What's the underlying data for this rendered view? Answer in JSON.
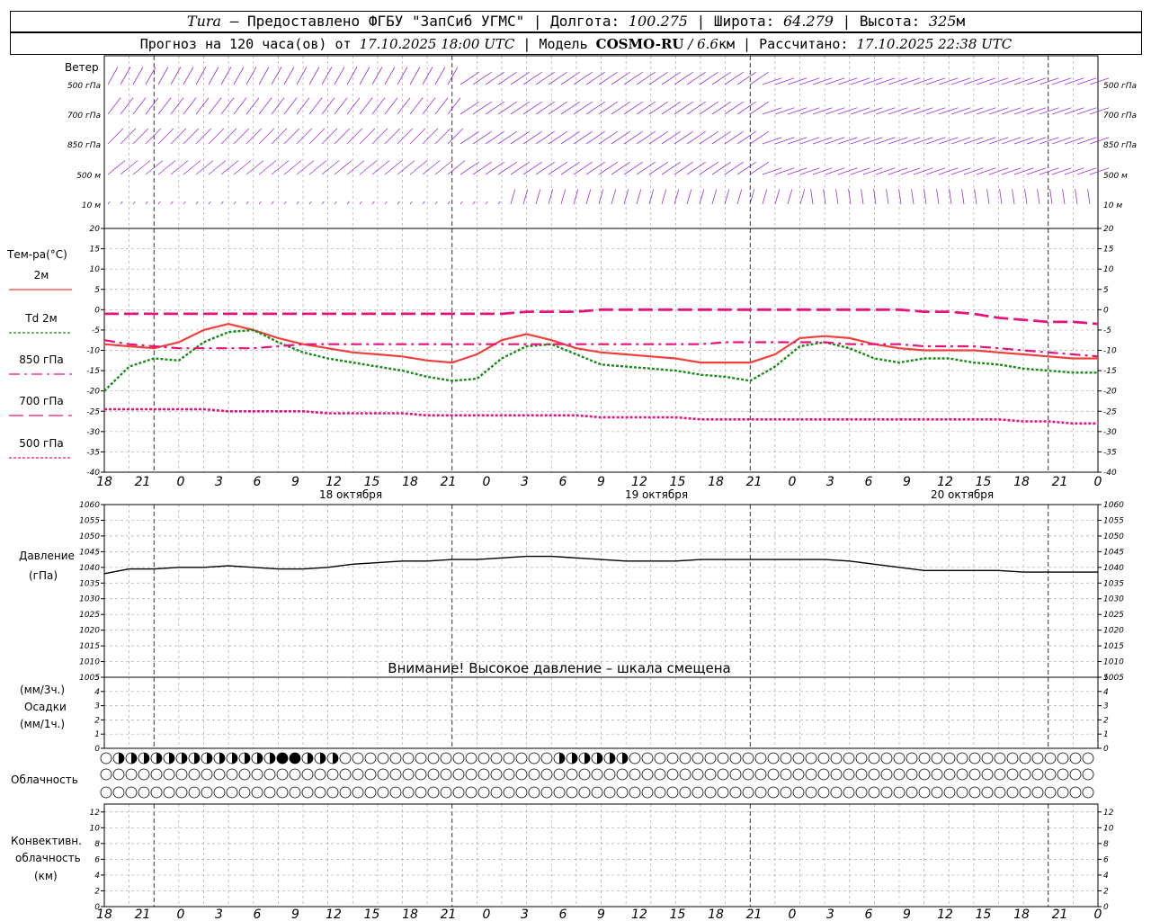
{
  "header": {
    "station": "Tura",
    "provider": " – Предоставлено ФГБУ \"ЗапСиб УГМС\" | Долгота: ",
    "lon": "100.275",
    "lat_label": " | Широта: ",
    "lat": "64.279",
    "alt_label": " | Высота: ",
    "alt": "325",
    "alt_unit": "м",
    "forecast_label": "Прогноз на 120 часа(ов) от ",
    "forecast_start": "17.10.2025 18:00 UTC",
    "model_label": " | Модель ",
    "model_name": "COSMO-RU",
    "model_res": " / 6.6",
    "model_res_unit": "км | Рассчитано: ",
    "computed": "17.10.2025 22:38 UTC"
  },
  "panels": {
    "wind_title": "Ветер",
    "wind_levels": [
      "500 гПа",
      "700 гПа",
      "850 гПа",
      "500 м",
      "10  м"
    ],
    "temp_title": "Тем-ра(°C)",
    "pressure_title": "Давление",
    "pressure_unit": "(гПа)",
    "pressure_warning": "Внимание! Высокое давление – шкала смещена",
    "precip_unit3": "(мм/3ч.)",
    "precip_title": "Осадки",
    "precip_unit1": "(мм/1ч.)",
    "cloud_title": "Облачность",
    "conv_title1": "Конвективн.",
    "conv_title2": "облачность",
    "conv_unit": "(км)"
  },
  "legend": [
    {
      "label": "2м",
      "color": "#f0403c",
      "style": "solid"
    },
    {
      "label": "Td  2м",
      "color": "#1a8a1a",
      "style": "dotted"
    },
    {
      "label": "850 гПа",
      "color": "#e6147a",
      "style": "dashdot"
    },
    {
      "label": "700 гПа",
      "color": "#e6147a",
      "style": "dashed"
    },
    {
      "label": "500 гПа",
      "color": "#e6147a",
      "style": "dotted"
    }
  ],
  "chart_data": [
    {
      "type": "line",
      "name": "temperature",
      "x_hours": [
        0,
        3,
        6,
        9,
        12,
        15,
        18,
        21,
        24,
        27,
        30,
        33,
        36,
        39,
        42,
        45,
        48,
        51,
        54,
        57,
        60,
        63,
        66,
        69,
        72,
        75,
        78,
        81,
        84,
        87,
        90,
        93,
        96,
        99,
        102,
        105,
        108,
        111,
        114,
        117,
        120
      ],
      "x_tick_labels": [
        "18",
        "21",
        "0",
        "3",
        "6",
        "9",
        "12",
        "15",
        "18",
        "21",
        "0",
        "3",
        "6",
        "9",
        "12",
        "15",
        "18",
        "21",
        "0",
        "3",
        "6",
        "9",
        "12",
        "15",
        "18",
        "21",
        "0"
      ],
      "day_labels": [
        "18 октября",
        "19 октября",
        "20 октября"
      ],
      "ylim": [
        -40,
        20
      ],
      "y_ticks": [
        20,
        15,
        10,
        5,
        0,
        -5,
        -10,
        -15,
        -20,
        -25,
        -30,
        -35,
        -40
      ],
      "series": [
        {
          "name": "2м",
          "values": [
            -8.5,
            -9,
            -9.5,
            -8,
            -5,
            -3.5,
            -5,
            -7,
            -8.5,
            -9.5,
            -10.5,
            -11,
            -11.5,
            -12.5,
            -13,
            -11,
            -7.5,
            -6,
            -7.5,
            -9.5,
            -10.5,
            -11,
            -11.5,
            -12,
            -13,
            -13,
            -13,
            -11,
            -7,
            -6.5,
            -7,
            -8.5,
            -9.5,
            -10,
            -10,
            -10,
            -10.5,
            -11,
            -11.5,
            -12,
            -12
          ]
        },
        {
          "name": "Td  2м",
          "values": [
            -20,
            -14,
            -12,
            -12.5,
            -8,
            -5.5,
            -5,
            -8,
            -10.5,
            -12,
            -13,
            -14,
            -15,
            -16.5,
            -17.5,
            -17,
            -12,
            -9,
            -8.5,
            -11,
            -13.5,
            -14,
            -14.5,
            -15,
            -16,
            -16.5,
            -17.5,
            -14,
            -9,
            -8,
            -9.5,
            -12,
            -13,
            -12,
            -12,
            -13,
            -13.5,
            -14.5,
            -15,
            -15.5,
            -15.5
          ]
        },
        {
          "name": "850 гПа",
          "values": [
            -7.5,
            -8.5,
            -9,
            -9.5,
            -9.5,
            -9.5,
            -9.5,
            -9,
            -8.5,
            -8.5,
            -8.5,
            -8.5,
            -8.5,
            -8.5,
            -8.5,
            -8.5,
            -8.5,
            -8.5,
            -8.5,
            -8.5,
            -8.5,
            -8.5,
            -8.5,
            -8.5,
            -8.5,
            -8,
            -8,
            -8,
            -8,
            -8,
            -8.5,
            -8.5,
            -8.5,
            -9,
            -9,
            -9,
            -9.5,
            -10,
            -10.5,
            -11,
            -11.5
          ]
        },
        {
          "name": "700 гПа",
          "values": [
            -1,
            -1,
            -1,
            -1,
            -1,
            -1,
            -1,
            -1,
            -1,
            -1,
            -1,
            -1,
            -1,
            -1,
            -1,
            -1,
            -1,
            -0.5,
            -0.5,
            -0.5,
            0,
            0,
            0,
            0,
            0,
            0,
            0,
            0,
            0,
            0,
            0,
            0,
            0,
            -0.5,
            -0.5,
            -1,
            -2,
            -2.5,
            -3,
            -3,
            -3.5
          ]
        },
        {
          "name": "500 гПа",
          "values": [
            -24.5,
            -24.5,
            -24.5,
            -24.5,
            -24.5,
            -25,
            -25,
            -25,
            -25,
            -25.5,
            -25.5,
            -25.5,
            -25.5,
            -26,
            -26,
            -26,
            -26,
            -26,
            -26,
            -26,
            -26.5,
            -26.5,
            -26.5,
            -26.5,
            -27,
            -27,
            -27,
            -27,
            -27,
            -27,
            -27,
            -27,
            -27,
            -27,
            -27,
            -27,
            -27,
            -27.5,
            -27.5,
            -28,
            -28
          ]
        }
      ]
    },
    {
      "type": "line",
      "name": "pressure",
      "ylim": [
        1005,
        1060
      ],
      "y_ticks": [
        1060,
        1055,
        1050,
        1045,
        1040,
        1035,
        1030,
        1025,
        1020,
        1015,
        1010,
        1005
      ],
      "series": [
        {
          "name": "pressure",
          "values": [
            1038,
            1039.5,
            1039.5,
            1040,
            1040,
            1040.5,
            1040,
            1039.5,
            1039.5,
            1040,
            1041,
            1041.5,
            1042,
            1042,
            1042.5,
            1042.5,
            1043,
            1043.5,
            1043.5,
            1043,
            1042.5,
            1042,
            1042,
            1042,
            1042.5,
            1042.5,
            1042.5,
            1042.5,
            1042.5,
            1042.5,
            1042,
            1041,
            1040,
            1039,
            1039,
            1039,
            1039,
            1038.5,
            1038.5,
            1038.5,
            1038.5
          ]
        }
      ]
    },
    {
      "type": "bar",
      "name": "precipitation",
      "ylim": [
        0,
        5
      ],
      "y_ticks": [
        5,
        4,
        3,
        2,
        1,
        0
      ],
      "values": []
    },
    {
      "type": "bar",
      "name": "convective_cloud",
      "ylim": [
        0,
        13
      ],
      "y_ticks": [
        12,
        10,
        8,
        6,
        4,
        2,
        0
      ],
      "values": []
    }
  ],
  "cloud_rows": {
    "row1": [
      0,
      1,
      2,
      2,
      2,
      2,
      2,
      2,
      2,
      1,
      1,
      2,
      2,
      2,
      3,
      3,
      2,
      2,
      1,
      0,
      0,
      0,
      0,
      0,
      0,
      0,
      0,
      0,
      0,
      0,
      0,
      0,
      0,
      0,
      0,
      0,
      1,
      2,
      2,
      2,
      2,
      2,
      0,
      0,
      0,
      0,
      0,
      0,
      0,
      0,
      0,
      0,
      0,
      0,
      0,
      0,
      0,
      0,
      0,
      0,
      0,
      0,
      0,
      0,
      0,
      0,
      0,
      0,
      0,
      0,
      0,
      0,
      0,
      0,
      0,
      0,
      0,
      0,
      0,
      0
    ],
    "row2": "empty",
    "row3": "empty"
  },
  "colors": {
    "wind": "#9b30d8",
    "grid": "#aaaaaa",
    "t2m": "#f0403c",
    "td": "#1a8a1a",
    "levels": "#e6147a",
    "pressure": "#000000"
  }
}
